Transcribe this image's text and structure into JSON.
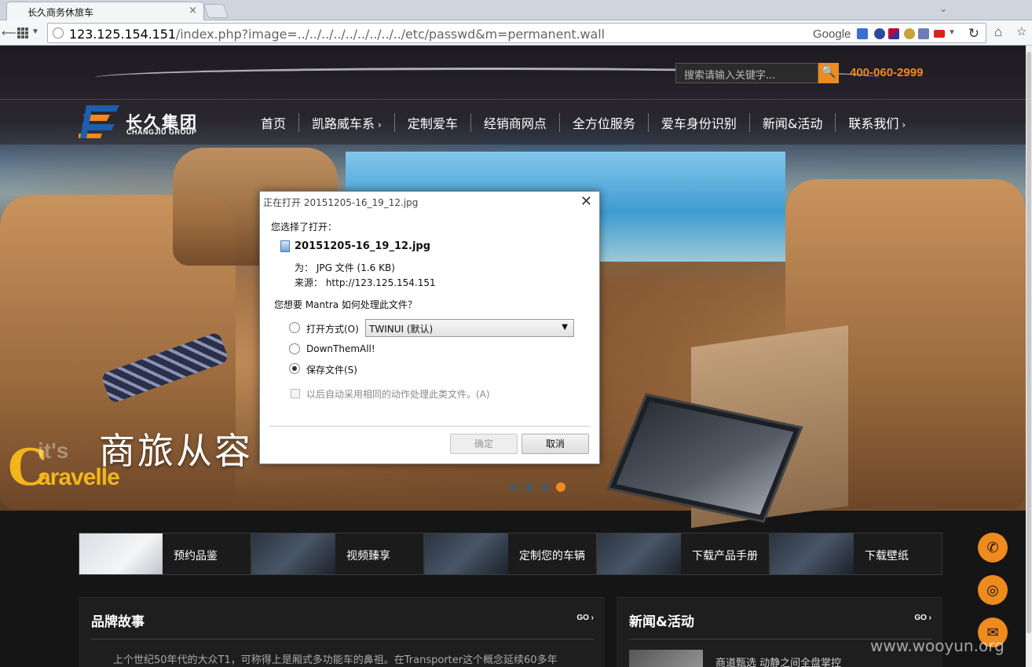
{
  "browser": {
    "tab_title": "长久商务休旅车",
    "tab_close": "×",
    "url_host": "123.125.154.151",
    "url_path": "/index.php?image=../../../../../../../../../etc/passwd&m=permanent.wall",
    "search_engine": "Google",
    "refresh": "↻",
    "home": "⌂",
    "star": "☆",
    "back": "⟵",
    "chevron": "⌄"
  },
  "site": {
    "search_placeholder": "搜索请输入关键字...",
    "search_button": "🔍",
    "phone": "400-060-2999",
    "logo_cn": "长久集团",
    "logo_en": "CHANGJIU GROUP",
    "nav": [
      {
        "label": "首页",
        "arrow": ""
      },
      {
        "label": "凯路威车系",
        "arrow": "›"
      },
      {
        "label": "定制爱车",
        "arrow": ""
      },
      {
        "label": "经销商网点",
        "arrow": ""
      },
      {
        "label": "全方位服务",
        "arrow": ""
      },
      {
        "label": "爱车身份识别",
        "arrow": ""
      },
      {
        "label": "新闻&活动",
        "arrow": ""
      },
      {
        "label": "联系我们",
        "arrow": "›"
      }
    ],
    "slogan": "商旅从容",
    "caravelle_c": "C",
    "caravelle_its": "it's",
    "caravelle_rest": "aravelle",
    "slider_dots": 4,
    "slider_active": 4,
    "features": [
      "预约品鉴",
      "视频臻享",
      "定制您的车辆",
      "下载产品手册",
      "下载壁纸"
    ],
    "brand_panel": {
      "title": "品牌故事",
      "go": "GO ›",
      "text": "上个世纪50年代的大众T1，可称得上是厢式多功能车的鼻祖。在Transporter这个概念延续60多年"
    },
    "news_panel": {
      "title": "新闻&活动",
      "go": "GO ›",
      "item": "商道甄选 动静之间全盘掌控"
    },
    "float_buttons": [
      "✆",
      "◎",
      "✉"
    ],
    "watermark": "www.wooyun.org"
  },
  "dialog": {
    "title": "正在打开 20151205-16_19_12.jpg",
    "close": "✕",
    "chosen_label": "您选择了打开：",
    "filename": "20151205-16_19_12.jpg",
    "type_line": "为：  JPG 文件 (1.6 KB)",
    "source_line": "来源：  http://123.125.154.151",
    "question": "您想要 Mantra 如何处理此文件？",
    "option_open": "打开方式(O)",
    "open_with_value": "TWINUI (默认)",
    "option_downthemall": "DownThemAll!",
    "option_save": "保存文件(S)",
    "selected_option": "save",
    "auto_checkbox": "以后自动采用相同的动作处理此类文件。(A)",
    "ok_button": "确定",
    "cancel_button": "取消"
  },
  "colors": {
    "accent": "#ef8a1e",
    "caravelle_yellow": "#f2b51a"
  }
}
